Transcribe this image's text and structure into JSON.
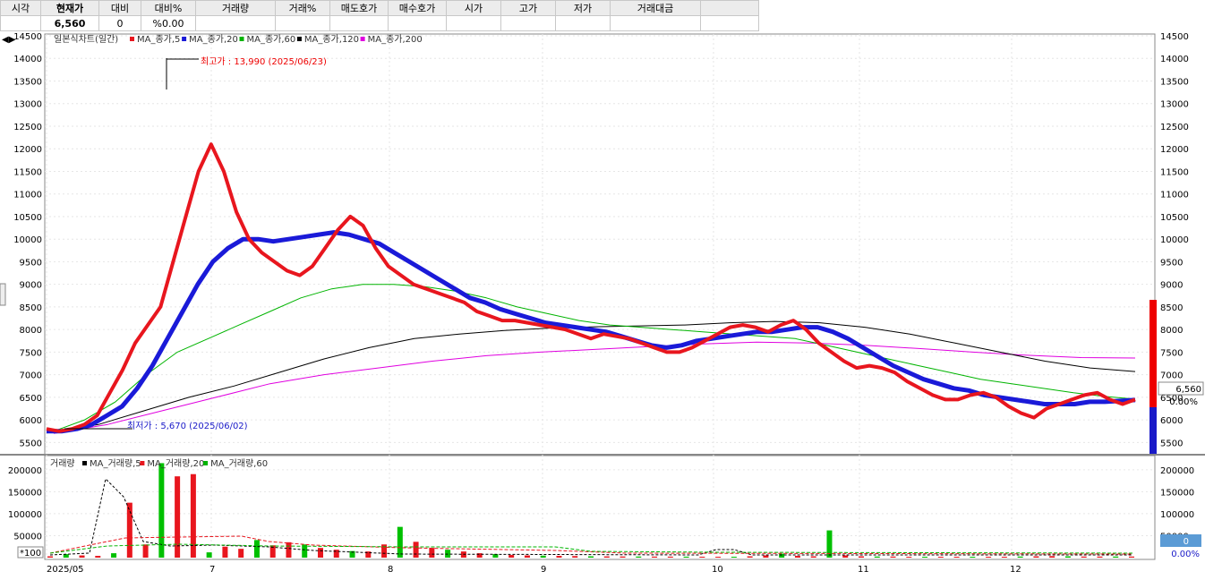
{
  "quote": {
    "headers": [
      "시각",
      "현재가",
      "대비",
      "대비%",
      "거래량",
      "거래%",
      "매도호가",
      "매수호가",
      "시가",
      "고가",
      "저가",
      "거래대금"
    ],
    "values": [
      "",
      "6,560",
      "0",
      "%0.00",
      "",
      "",
      "",
      "",
      "",
      "",
      "",
      ""
    ]
  },
  "legend_price": {
    "title": "일본식차트(일간)",
    "items": [
      {
        "label": "MA_종가,5",
        "color": "#e8161e"
      },
      {
        "label": "MA_종가,20",
        "color": "#1a1ad8"
      },
      {
        "label": "MA_종가,60",
        "color": "#00b400"
      },
      {
        "label": "MA_종가,120",
        "color": "#000000"
      },
      {
        "label": "MA_종가,200",
        "color": "#e000e0"
      }
    ]
  },
  "legend_volume": {
    "title": "거래량",
    "items": [
      {
        "label": "MA_거래량,5",
        "color": "#000000"
      },
      {
        "label": "MA_거래량,20",
        "color": "#e8161e"
      },
      {
        "label": "MA_거래량,60",
        "color": "#00b400"
      }
    ]
  },
  "annotations": {
    "high": "최고가 : 13,990 (2025/06/23)",
    "low": "최저가 : 5,670 (2025/06/02)"
  },
  "right_panel": {
    "price": "6,560",
    "pct": "0.00%",
    "vol": "0",
    "vol_pct": "0.00%"
  },
  "unit_badge": "*100",
  "chart_data": {
    "type": "candlestick",
    "title": "일본식차트(일간)",
    "price_axis": {
      "min": 5500,
      "max": 14500,
      "step": 500,
      "ticks": [
        "5500",
        "6000",
        "6500",
        "7000",
        "7500",
        "8000",
        "8500",
        "9000",
        "9500",
        "10000",
        "10500",
        "11000",
        "11500",
        "12000",
        "12500",
        "13000",
        "13500",
        "14000",
        "14500"
      ]
    },
    "volume_axis": {
      "ticks": [
        "200000",
        "150000",
        "100000",
        "50000"
      ]
    },
    "x_labels": [
      "2025/05",
      "7",
      "8",
      "9",
      "10",
      "11",
      "12"
    ],
    "ma5": [
      5800,
      5750,
      5800,
      5900,
      6100,
      6600,
      7100,
      7700,
      8100,
      8500,
      9500,
      10500,
      11500,
      12100,
      11500,
      10600,
      10000,
      9700,
      9500,
      9300,
      9200,
      9400,
      9800,
      10200,
      10500,
      10300,
      9800,
      9400,
      9200,
      9000,
      8900,
      8800,
      8700,
      8600,
      8400,
      8300,
      8200,
      8200,
      8150,
      8100,
      8050,
      8000,
      7900,
      7800,
      7900,
      7850,
      7800,
      7700,
      7600,
      7500,
      7500,
      7600,
      7750,
      7900,
      8050,
      8100,
      8050,
      7950,
      8100,
      8200,
      8000,
      7700,
      7500,
      7300,
      7150,
      7200,
      7150,
      7050,
      6850,
      6700,
      6550,
      6450,
      6450,
      6550,
      6600,
      6500,
      6300,
      6150,
      6050,
      6250,
      6350,
      6450,
      6550,
      6600,
      6450,
      6350,
      6450
    ],
    "ma20": [
      5750,
      5750,
      5800,
      5900,
      6100,
      6300,
      6700,
      7200,
      7800,
      8400,
      9000,
      9500,
      9800,
      10000,
      10000,
      9950,
      10000,
      10050,
      10100,
      10150,
      10100,
      10000,
      9900,
      9700,
      9500,
      9300,
      9100,
      8900,
      8700,
      8600,
      8450,
      8350,
      8250,
      8150,
      8100,
      8050,
      8000,
      7950,
      7850,
      7750,
      7650,
      7600,
      7650,
      7750,
      7800,
      7850,
      7900,
      7950,
      7950,
      8000,
      8050,
      8050,
      7950,
      7800,
      7600,
      7400,
      7200,
      7050,
      6900,
      6800,
      6700,
      6650,
      6550,
      6500,
      6450,
      6400,
      6350,
      6350,
      6350,
      6400,
      6400,
      6420,
      6440
    ],
    "ma60": [
      5750,
      6000,
      6400,
      7000,
      7500,
      7800,
      8100,
      8400,
      8700,
      8900,
      9000,
      9000,
      8950,
      8850,
      8700,
      8500,
      8350,
      8200,
      8100,
      8050,
      8000,
      7950,
      7900,
      7850,
      7800,
      7650,
      7500,
      7350,
      7200,
      7050,
      6900,
      6800,
      6700,
      6600,
      6520,
      6460
    ],
    "ma120": [
      5750,
      5900,
      6200,
      6500,
      6750,
      7050,
      7350,
      7600,
      7800,
      7900,
      7980,
      8030,
      8060,
      8080,
      8100,
      8150,
      8180,
      8150,
      8050,
      7900,
      7700,
      7500,
      7300,
      7150,
      7070
    ],
    "ma200": [
      5700,
      5900,
      6200,
      6500,
      6800,
      7000,
      7150,
      7300,
      7420,
      7500,
      7560,
      7620,
      7680,
      7720,
      7700,
      7650,
      7580,
      7500,
      7430,
      7380,
      7370
    ],
    "volume_bars": [
      3000,
      8000,
      5000,
      4000,
      10000,
      125000,
      30000,
      215000,
      185000,
      190000,
      12000,
      25000,
      20000,
      40000,
      28000,
      35000,
      30000,
      22000,
      18000,
      15000,
      14000,
      30000,
      70000,
      36000,
      22000,
      18000,
      14000,
      10000,
      8000,
      6000,
      5000,
      4500,
      4000,
      3500,
      3000,
      2800,
      2600,
      2500,
      2400,
      2300,
      2200,
      2100,
      2000,
      2000,
      3000,
      5000,
      9000,
      4000,
      3000,
      62000,
      5000,
      3000,
      2500,
      2500,
      2000,
      2000,
      2000,
      2000,
      2000,
      2000,
      2000,
      2500,
      3000,
      3500,
      3000,
      2500,
      2500,
      2500,
      2500
    ]
  }
}
